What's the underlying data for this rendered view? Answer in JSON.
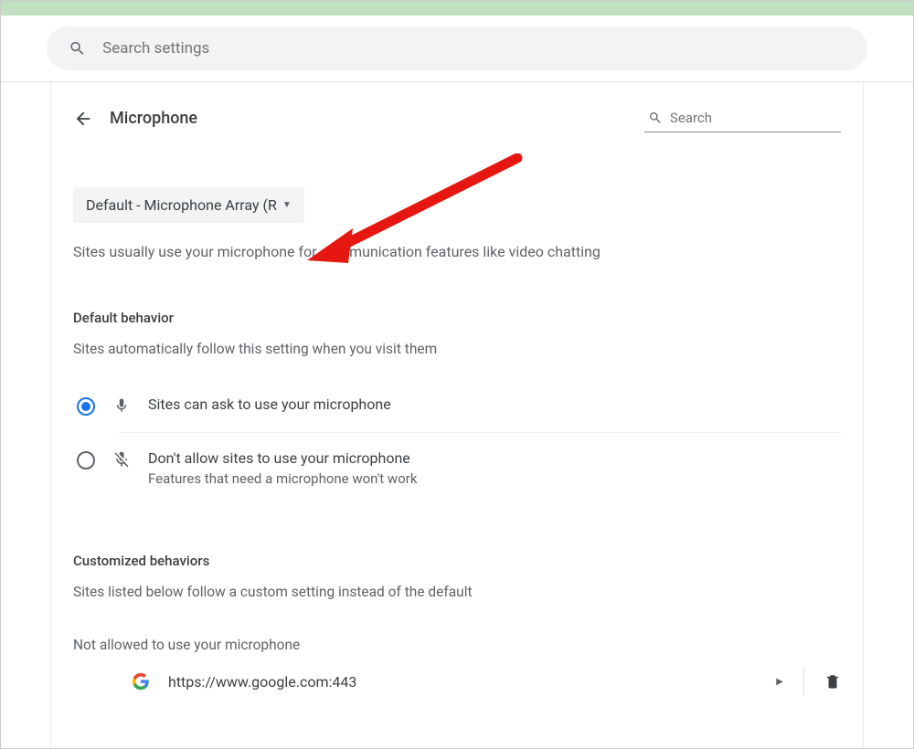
{
  "top_search": {
    "placeholder": "Search settings"
  },
  "header": {
    "title": "Microphone",
    "search_placeholder": "Search"
  },
  "device_selector": {
    "text": "Default - Microphone Array (R"
  },
  "usage_hint": "Sites usually use your microphone for communication features like video chatting",
  "default_behavior": {
    "heading": "Default behavior",
    "subtext": "Sites automatically follow this setting when you visit them",
    "options": [
      {
        "label": "Sites can ask to use your microphone",
        "sub": "",
        "selected": true
      },
      {
        "label": "Don't allow sites to use your microphone",
        "sub": "Features that need a microphone won't work",
        "selected": false
      }
    ]
  },
  "customized": {
    "heading": "Customized behaviors",
    "subtext": "Sites listed below follow a custom setting instead of the default",
    "not_allowed_label": "Not allowed to use your microphone",
    "sites": [
      {
        "url": "https://www.google.com:443"
      }
    ]
  }
}
